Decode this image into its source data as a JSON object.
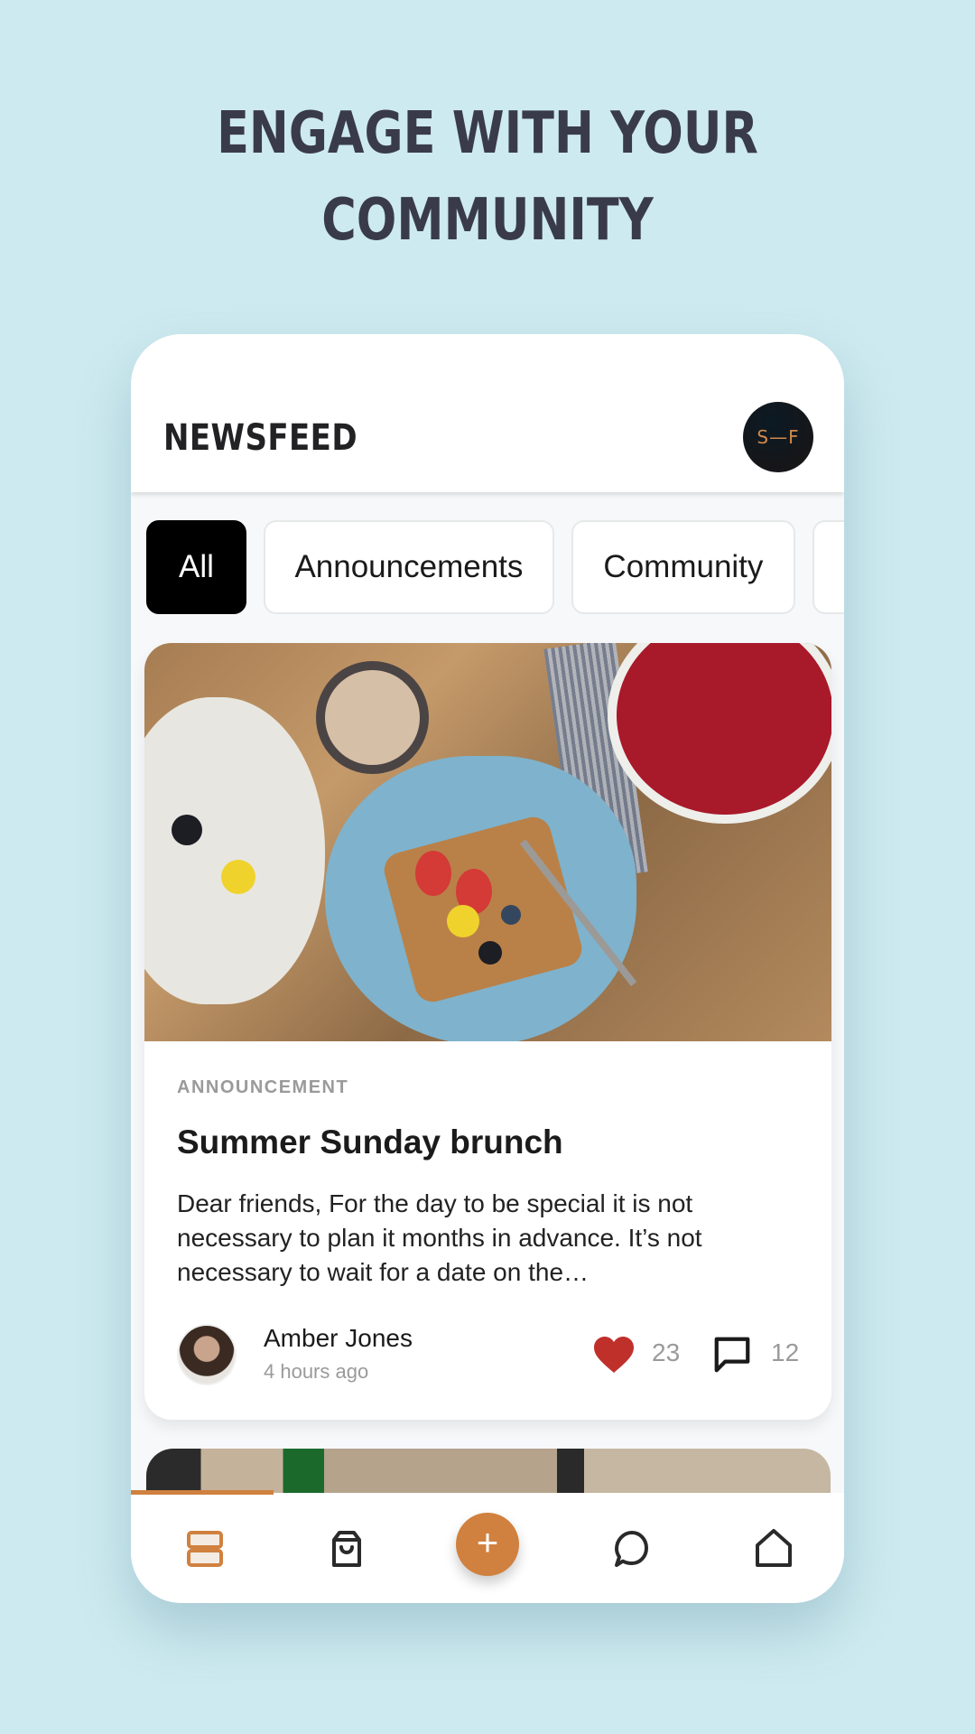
{
  "headline": {
    "line1": "ENGAGE WITH YOUR",
    "line2": "COMMUNITY"
  },
  "appbar": {
    "title": "NEWSFEED",
    "brand_avatar_text": "S—F"
  },
  "filters": {
    "chips": [
      {
        "label": "All",
        "active": true
      },
      {
        "label": "Announcements",
        "active": false
      },
      {
        "label": "Community",
        "active": false
      },
      {
        "label": "",
        "active": false
      }
    ]
  },
  "feed": {
    "posts": [
      {
        "image_alt": "Brunch table with french toast, berries and coffee",
        "category": "ANNOUNCEMENT",
        "title": "Summer Sunday brunch",
        "excerpt": "Dear friends, For the day to be special it is not necessary to plan it months in advance. It’s not necessary to wait for a date on the…",
        "author": {
          "name": "Amber Jones",
          "time": "4 hours ago"
        },
        "likes": "23",
        "comments": "12"
      },
      {
        "image_alt": "Gym interior"
      }
    ]
  },
  "scroll_progress": 0.2,
  "bottom_nav": {
    "items": [
      {
        "name": "feed",
        "icon": "feed-icon",
        "active": true
      },
      {
        "name": "shop",
        "icon": "shopping-bag-icon",
        "active": false
      },
      {
        "name": "create",
        "icon": "plus-icon",
        "label": "+"
      },
      {
        "name": "messages",
        "icon": "chat-bubble-icon",
        "active": false
      },
      {
        "name": "home",
        "icon": "home-icon",
        "active": false
      }
    ]
  },
  "colors": {
    "background": "#cdeaf0",
    "accent": "#d0813f",
    "heart": "#c0302b",
    "headline": "#3a3b4a"
  }
}
